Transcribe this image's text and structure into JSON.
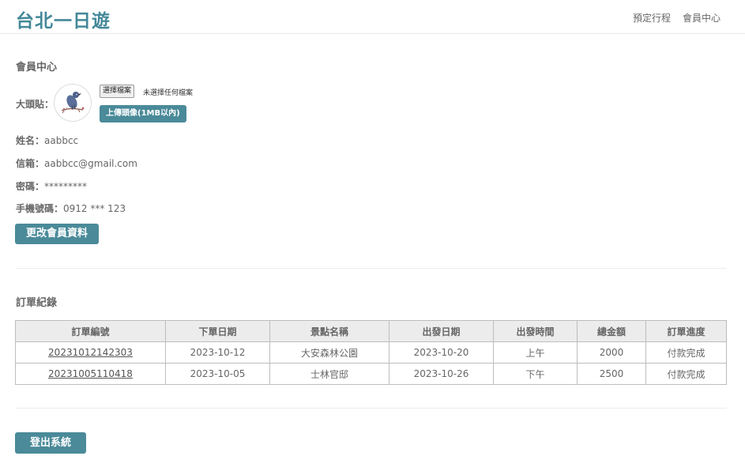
{
  "header": {
    "brand": "台北一日遊",
    "nav": [
      {
        "label": "預定行程"
      },
      {
        "label": "會員中心"
      }
    ]
  },
  "member": {
    "title": "會員中心",
    "avatar_label": "大頭貼：",
    "file_button": "選擇檔案",
    "file_status": "未選擇任何檔案",
    "upload_button": "上傳頭像(1MB以內)",
    "name_label": "姓名：",
    "name": "aabbcc",
    "email_label": "信箱：",
    "email": "aabbcc@gmail.com",
    "password_label": "密碼：",
    "password": "*********",
    "phone_label": "手機號碼：",
    "phone": "0912 *** 123",
    "edit_button": "更改會員資料"
  },
  "orders": {
    "title": "訂單紀錄",
    "columns": [
      "訂單編號",
      "下單日期",
      "景點名稱",
      "出發日期",
      "出發時間",
      "總金額",
      "訂單進度"
    ],
    "rows": [
      [
        "20231012142303",
        "2023-10-12",
        "大安森林公園",
        "2023-10-20",
        "上午",
        "2000",
        "付款完成"
      ],
      [
        "20231005110418",
        "2023-10-05",
        "士林官邸",
        "2023-10-26",
        "下午",
        "2500",
        "付款完成"
      ]
    ]
  },
  "logout_button": "登出系統",
  "colors": {
    "brand": "#448899",
    "button": "#4a8a99",
    "text": "#666666",
    "table_header_bg": "#ececec"
  }
}
